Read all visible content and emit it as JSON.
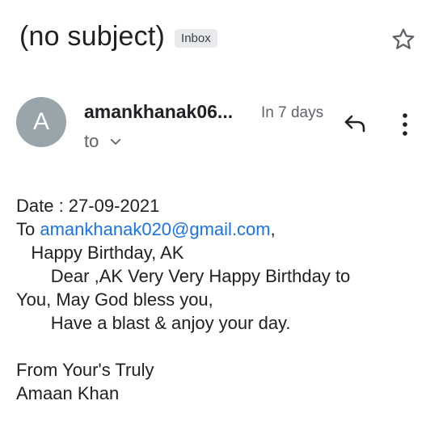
{
  "header": {
    "subject": "(no subject)",
    "label": "Inbox",
    "star_icon": "star-outline-icon"
  },
  "sender": {
    "avatar_letter": "A",
    "avatar_color": "#9aa4ab",
    "name": "amankhanak06...",
    "date": "In 7 days",
    "to_label": "to",
    "reply_icon": "reply-icon",
    "more_icon": "more-vertical-icon"
  },
  "body": {
    "date_line": "Date : 27-09-2021",
    "to_prefix": "To ",
    "to_email": "amankhanak020@gmail.com",
    "to_suffix": ",",
    "greeting": "   Happy Birthday, AK",
    "line1": "       Dear ,AK Very Very Happy Birthday to",
    "line2": "You, May God bless you,",
    "line3": "       Have a blast & anjoy your day.",
    "closing": "From Your's Truly",
    "signature": "Amaan Khan"
  },
  "colors": {
    "link": "#1a73e8",
    "text": "#202124",
    "secondary": "#5f6368",
    "badge_bg": "#e8eaed"
  }
}
